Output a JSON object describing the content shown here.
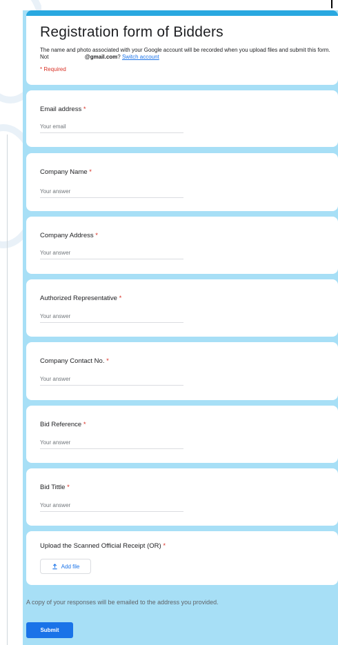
{
  "form": {
    "title": "Registration form of Bidders",
    "info_text": "The name and photo associated with your Google account will be recorded when you upload files and submit this form. Not",
    "account_email": "@gmail.com",
    "switch_account": "Switch account",
    "required_note": "* Required"
  },
  "questions": [
    {
      "label": "Email address",
      "placeholder": "Your email"
    },
    {
      "label": "Company Name",
      "placeholder": "Your answer"
    },
    {
      "label": "Company Address",
      "placeholder": "Your answer"
    },
    {
      "label": "Authorized Representative",
      "placeholder": "Your answer"
    },
    {
      "label": "Company Contact No.",
      "placeholder": "Your answer"
    },
    {
      "label": "Bid Reference",
      "placeholder": "Your answer"
    },
    {
      "label": "Bid Tittle",
      "placeholder": "Your answer"
    }
  ],
  "upload": {
    "label": "Upload the Scanned Official Receipt (OR)",
    "button": "Add file",
    "icon": "upload-icon"
  },
  "required_star": "*",
  "footer": {
    "note": "A copy of your responses will be emailed to the address you provided.",
    "submit": "Submit"
  },
  "colors": {
    "accent": "#29a8e0",
    "background": "#a7dff6",
    "required": "#d93025",
    "button": "#1a73e8"
  }
}
